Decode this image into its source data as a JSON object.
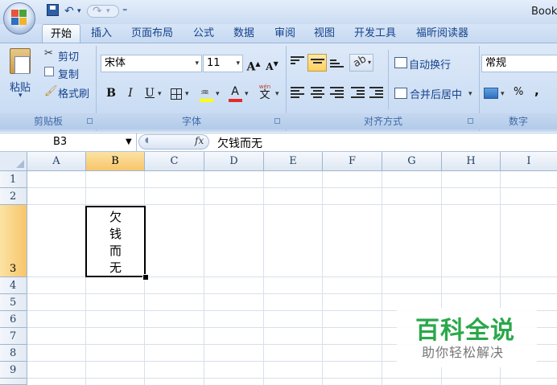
{
  "window": {
    "title": "Book"
  },
  "quick_access": {
    "dropdown_glyph": "▾",
    "customize_glyph": "⁼",
    "undo_glyph": "↶",
    "redo_glyph": "↷"
  },
  "ribbon": {
    "tabs": [
      "开始",
      "插入",
      "页面布局",
      "公式",
      "数据",
      "审阅",
      "视图",
      "开发工具",
      "福昕阅读器"
    ],
    "active_tab": "开始",
    "clipboard": {
      "paste": "粘贴",
      "cut": "剪切",
      "copy": "复制",
      "format_painter": "格式刷",
      "label": "剪贴板"
    },
    "font": {
      "name": "宋体",
      "size": "11",
      "grow": "A",
      "shrink": "A",
      "bold": "B",
      "italic": "I",
      "underline": "U",
      "font_color_letter": "A",
      "phonetic_top": "wén",
      "phonetic": "文",
      "label": "字体"
    },
    "alignment": {
      "wrap_text": "自动换行",
      "merge_center": "合并后居中",
      "label": "对齐方式"
    },
    "number": {
      "format": "常规",
      "percent": "%",
      "comma": ",",
      "label": "数字"
    }
  },
  "formula_bar": {
    "name_box": "B3",
    "fx": "fx",
    "content": "欠钱而无"
  },
  "sheet": {
    "columns": [
      "A",
      "B",
      "C",
      "D",
      "E",
      "F",
      "G",
      "H",
      "I"
    ],
    "selected_column": "B",
    "rows": [
      "1",
      "2",
      "3",
      "4",
      "5",
      "6",
      "7",
      "8",
      "9"
    ],
    "selected_row": "3",
    "active_cell": {
      "ref": "B3",
      "lines": [
        "欠",
        "钱",
        "而",
        "无"
      ]
    }
  },
  "watermark": {
    "title": "百科全说",
    "subtitle": "助你轻松解决"
  },
  "colors": {
    "ribbon_bg": "#cfe0f5",
    "tab_text": "#15428b",
    "selected_header": "#f8c56a",
    "watermark_green": "#2aa84a"
  }
}
